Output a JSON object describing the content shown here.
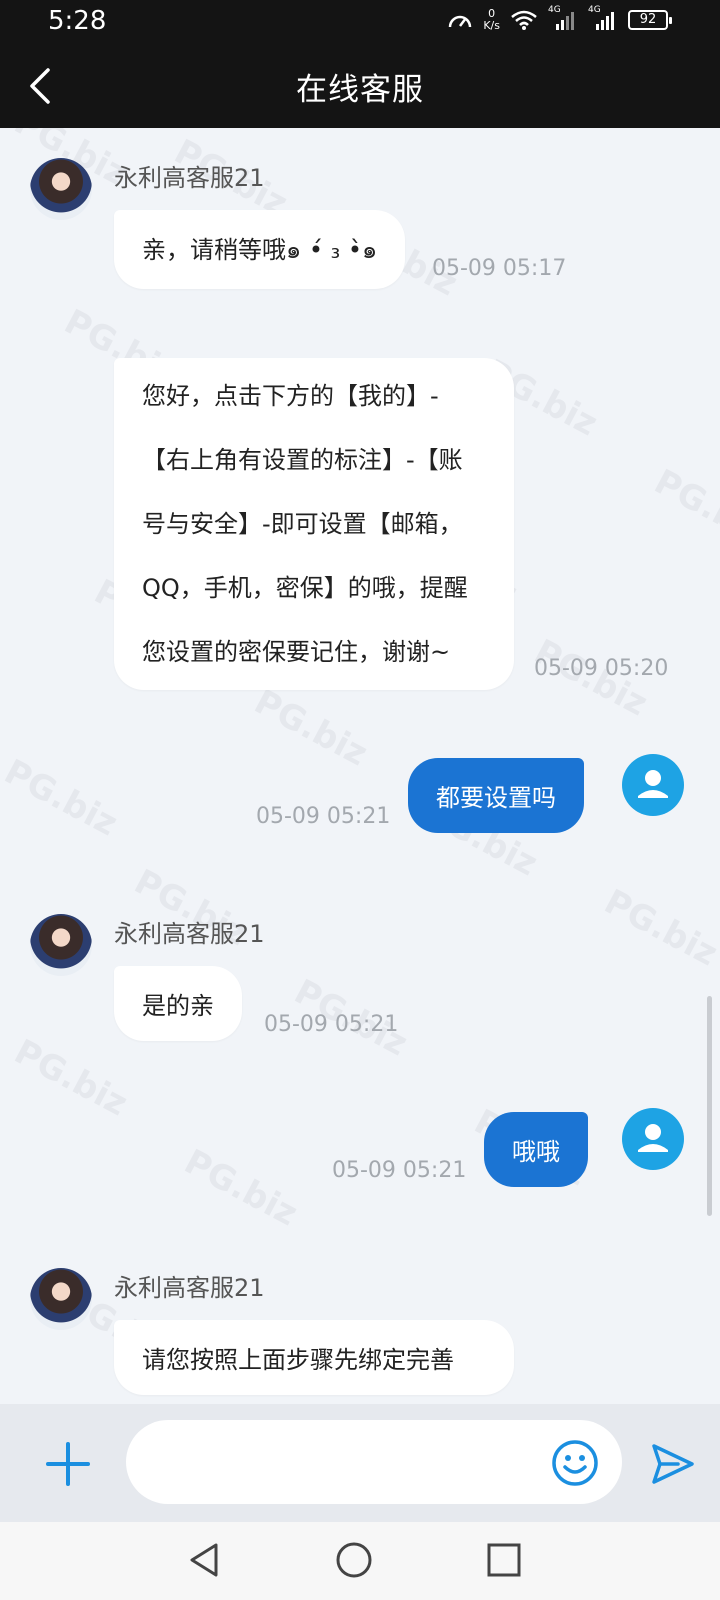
{
  "status_bar": {
    "time": "5:28",
    "net_speed_value": "0",
    "net_speed_unit": "K/s",
    "signal1": "4G",
    "signal2": "4G",
    "battery": "92"
  },
  "header": {
    "title": "在线客服"
  },
  "messages": [
    {
      "side": "agent",
      "name": "永利高客服21",
      "text": "亲，请稍等哦๑ •́ ₃ •̀๑",
      "time": "05-09 05:17"
    },
    {
      "side": "agent",
      "lines": [
        "您好，点击下方的【我的】-",
        "【右上角有设置的标注】-【账",
        "号与安全】-即可设置【邮箱，",
        "QQ，手机，密保】的哦，提醒",
        "您设置的密保要记住，谢谢~"
      ],
      "time": "05-09 05:20"
    },
    {
      "side": "user",
      "text": "都要设置吗",
      "time": "05-09 05:21"
    },
    {
      "side": "agent",
      "name": "永利高客服21",
      "text": "是的亲",
      "time": "05-09 05:21"
    },
    {
      "side": "user",
      "text": "哦哦",
      "time": "05-09 05:21"
    },
    {
      "side": "agent",
      "name": "永利高客服21",
      "text": "请您按照上面步骤先绑定完善"
    }
  ],
  "composer": {
    "placeholder": ""
  },
  "icons": {
    "back": "chevron-left-icon",
    "add": "plus-icon",
    "emoji": "smiley-icon",
    "send": "send-icon",
    "nav_back": "triangle-back-icon",
    "nav_home": "circle-home-icon",
    "nav_recent": "square-recent-icon"
  },
  "colors": {
    "header_bg": "#141414",
    "chat_bg": "#f1f4f8",
    "user_bubble": "#1b74d3",
    "user_avatar": "#1ea3e4",
    "accent_icon": "#1b8fe0"
  }
}
